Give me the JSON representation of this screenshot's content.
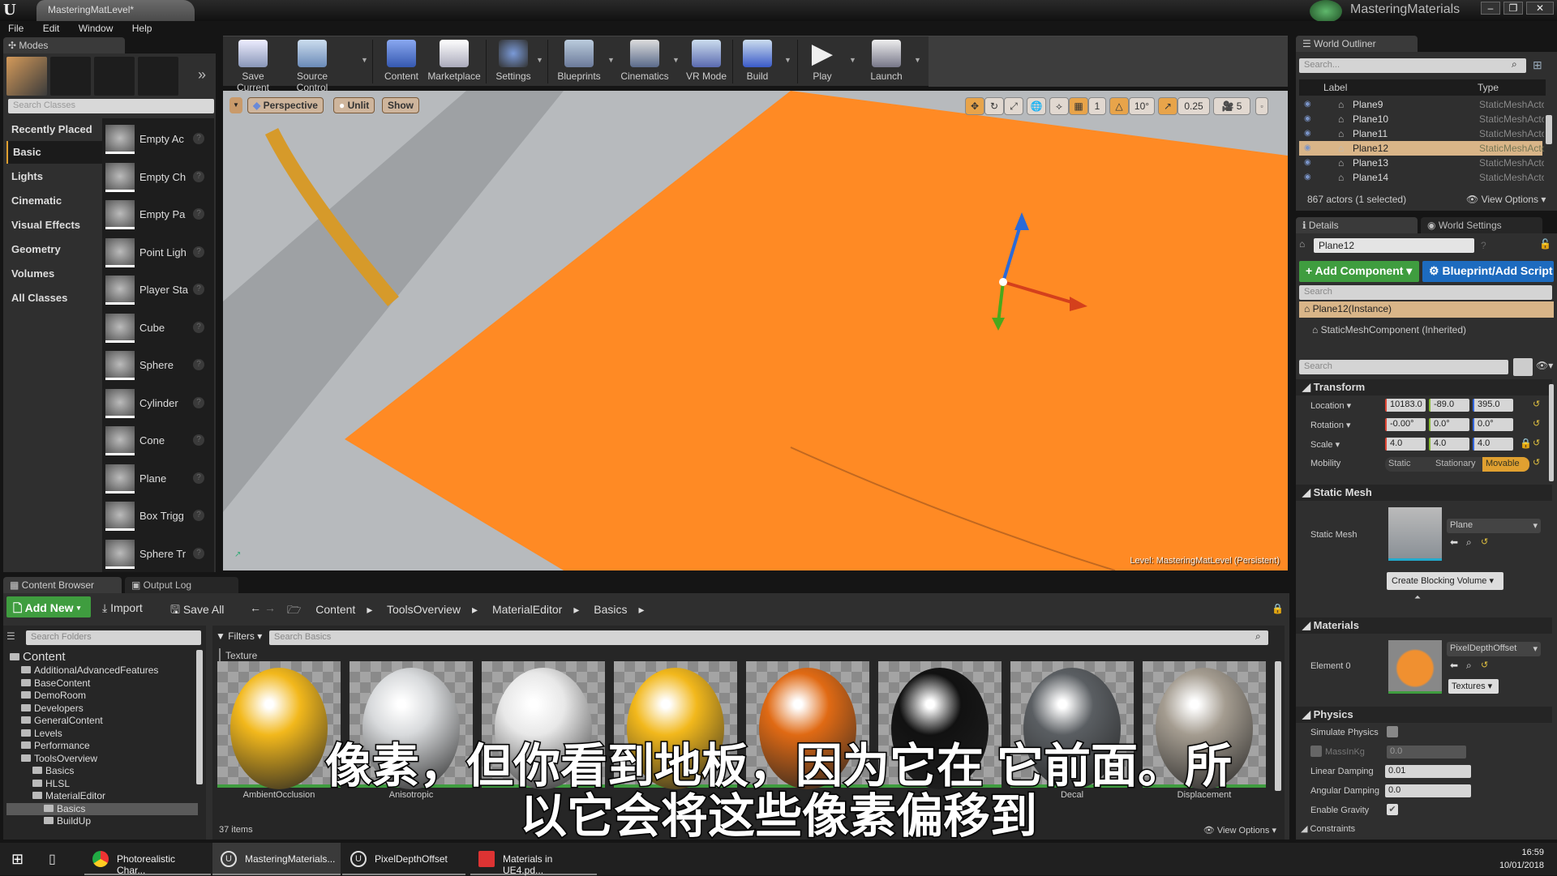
{
  "window": {
    "doc_tab": "MasteringMatLevel*",
    "project": "MasteringMaterials"
  },
  "menu": [
    "File",
    "Edit",
    "Window",
    "Help"
  ],
  "modes": {
    "tab": "Modes",
    "search_placeholder": "Search Classes",
    "categories": [
      "Recently Placed",
      "Basic",
      "Lights",
      "Cinematic",
      "Visual Effects",
      "Geometry",
      "Volumes",
      "All Classes"
    ],
    "active_category": "Basic",
    "classes": [
      "Empty Ac",
      "Empty Ch",
      "Empty Pa",
      "Point Ligh",
      "Player Sta",
      "Cube",
      "Sphere",
      "Cylinder",
      "Cone",
      "Plane",
      "Box Trigg",
      "Sphere Tr"
    ]
  },
  "toolbar": [
    "Save Current",
    "Source Control",
    "Content",
    "Marketplace",
    "Settings",
    "Blueprints",
    "Cinematics",
    "VR Mode",
    "Build",
    "Play",
    "Launch"
  ],
  "viewport": {
    "view_mode": "Perspective",
    "lighting": "Unlit",
    "show": "Show",
    "grid_snap": "1",
    "rotation_snap": "10°",
    "scale_snap": "0.25",
    "camera_speed": "5",
    "level_label": "Level:  MasteringMatLevel (Persistent)",
    "floor_color": "#ff8a24"
  },
  "outliner": {
    "tab": "World Outliner",
    "search_placeholder": "Search...",
    "col_label": "Label",
    "col_type": "Type",
    "rows": [
      {
        "label": "Plane9",
        "type": "StaticMeshActor"
      },
      {
        "label": "Plane10",
        "type": "StaticMeshActor"
      },
      {
        "label": "Plane11",
        "type": "StaticMeshActor"
      },
      {
        "label": "Plane12",
        "type": "StaticMeshActor",
        "selected": true
      },
      {
        "label": "Plane13",
        "type": "StaticMeshActor"
      },
      {
        "label": "Plane14",
        "type": "StaticMeshActor"
      }
    ],
    "footer": "867 actors (1 selected)",
    "view_options": "View Options"
  },
  "details": {
    "tab": "Details",
    "world_settings_tab": "World Settings",
    "name": "Plane12",
    "add_component": "+ Add Component",
    "blueprint_btn": "Blueprint/Add Script",
    "search_placeholder": "Search",
    "components": [
      "Plane12(Instance)",
      "StaticMeshComponent (Inherited)"
    ],
    "transform": {
      "title": "Transform",
      "location_label": "Location",
      "location": [
        "10183.0",
        "-89.0",
        "395.0"
      ],
      "rotation_label": "Rotation",
      "rotation": [
        "-0.00°",
        "0.0°",
        "0.0°"
      ],
      "scale_label": "Scale",
      "scale": [
        "4.0",
        "4.0",
        "4.0"
      ],
      "mobility_label": "Mobility",
      "mobility": [
        "Static",
        "Stationary",
        "Movable"
      ],
      "mobility_selected": "Movable"
    },
    "static_mesh": {
      "title": "Static Mesh",
      "label": "Static Mesh",
      "value": "Plane",
      "blocking_btn": "Create Blocking Volume"
    },
    "materials": {
      "title": "Materials",
      "element_label": "Element 0",
      "value": "PixelDepthOffset",
      "textures_btn": "Textures"
    },
    "physics": {
      "title": "Physics",
      "simulate_label": "Simulate Physics",
      "simulate": false,
      "mass_label": "MassInKg",
      "mass": "0.0",
      "linear_label": "Linear Damping",
      "linear": "0.01",
      "angular_label": "Angular Damping",
      "angular": "0.0",
      "gravity_label": "Enable Gravity",
      "gravity": true,
      "constraints": "Constraints"
    }
  },
  "content_browser": {
    "tab": "Content Browser",
    "output_tab": "Output Log",
    "add_new": "Add New",
    "import": "Import",
    "save_all": "Save All",
    "breadcrumbs": [
      "Content",
      "ToolsOverview",
      "MaterialEditor",
      "Basics"
    ],
    "folder_search": "Search Folders",
    "filters": "Filters",
    "asset_search": "Search Basics",
    "filter_chip": "Texture",
    "tree": [
      {
        "label": "Content",
        "depth": 0
      },
      {
        "label": "AdditionalAdvancedFeatures",
        "depth": 1
      },
      {
        "label": "BaseContent",
        "depth": 1
      },
      {
        "label": "DemoRoom",
        "depth": 1
      },
      {
        "label": "Developers",
        "depth": 1
      },
      {
        "label": "GeneralContent",
        "depth": 1
      },
      {
        "label": "Levels",
        "depth": 1
      },
      {
        "label": "Performance",
        "depth": 1
      },
      {
        "label": "ToolsOverview",
        "depth": 1
      },
      {
        "label": "Basics",
        "depth": 2
      },
      {
        "label": "HLSL",
        "depth": 2
      },
      {
        "label": "MaterialEditor",
        "depth": 2
      },
      {
        "label": "Basics",
        "depth": 3,
        "selected": true
      },
      {
        "label": "BuildUp",
        "depth": 3
      }
    ],
    "assets": [
      {
        "name": "AmbientOcclusion",
        "color": "#f2b81c"
      },
      {
        "name": "Anisotropic",
        "color": "#d8dadc"
      },
      {
        "name": "",
        "color": "#e8e8e8"
      },
      {
        "name": "",
        "color": "#f2b81c"
      },
      {
        "name": "",
        "color": "#e06a14"
      },
      {
        "name": "",
        "color": "#111111"
      },
      {
        "name": "Decal",
        "color": "#5a5e62"
      },
      {
        "name": "Displacement",
        "color": "#a49c90"
      }
    ],
    "item_count": "37 items",
    "view_options": "View Options"
  },
  "subtitle": {
    "line1": "像素，但你看到地板，因为它在 它前面。所",
    "line2": "以它会将这些像素偏移到"
  },
  "taskbar": {
    "items": [
      "Photorealistic Char...",
      "MasteringMaterials...",
      "PixelDepthOffset",
      "Materials in UE4.pd..."
    ],
    "time": "16:59",
    "date": "10/01/2018"
  }
}
